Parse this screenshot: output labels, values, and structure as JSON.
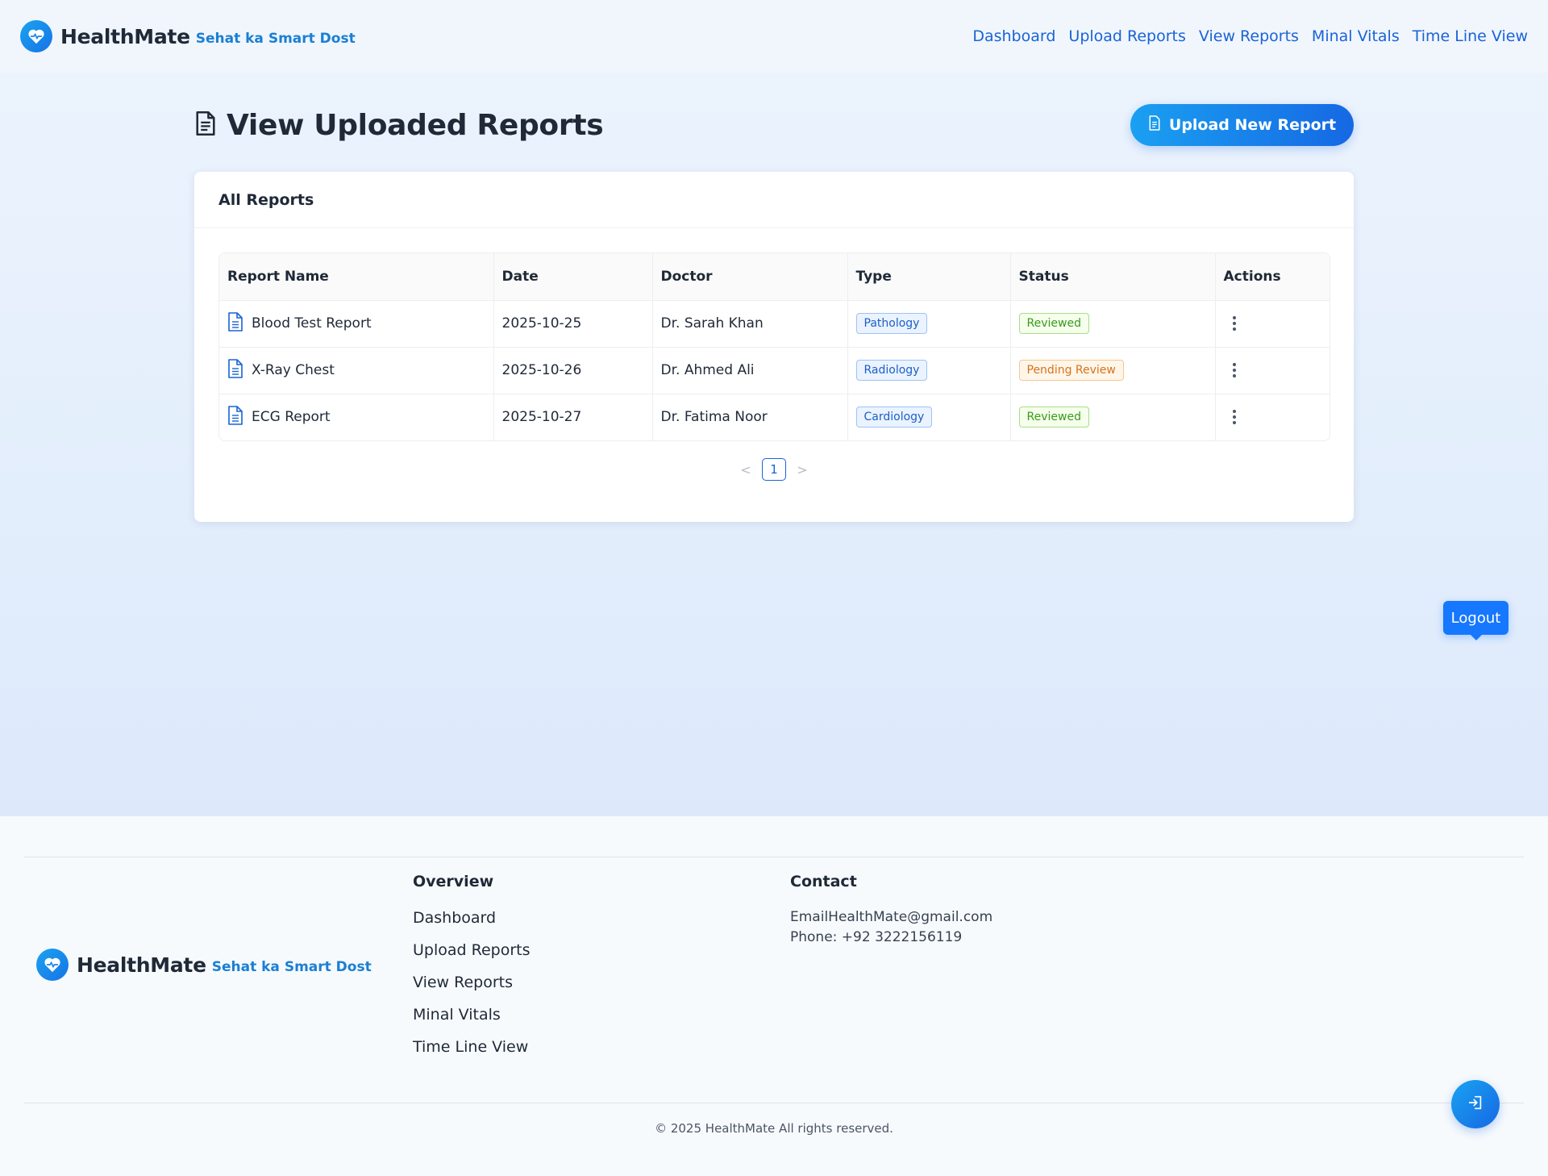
{
  "brand": {
    "name": "HealthMate",
    "tagline": "Sehat ka Smart Dost"
  },
  "nav": {
    "items": [
      {
        "label": "Dashboard"
      },
      {
        "label": "Upload Reports"
      },
      {
        "label": "View Reports"
      },
      {
        "label": "Minal Vitals"
      },
      {
        "label": "Time Line View"
      }
    ]
  },
  "page": {
    "title": "View Uploaded Reports",
    "upload_button_label": "Upload New Report"
  },
  "card": {
    "title": "All Reports",
    "columns": [
      "Report Name",
      "Date",
      "Doctor",
      "Type",
      "Status",
      "Actions"
    ],
    "rows": [
      {
        "name": "Blood Test Report",
        "date": "2025-10-25",
        "doctor": "Dr. Sarah Khan",
        "type": "Pathology",
        "status": "Reviewed",
        "status_color": "green"
      },
      {
        "name": "X-Ray Chest",
        "date": "2025-10-26",
        "doctor": "Dr. Ahmed Ali",
        "type": "Radiology",
        "status": "Pending Review",
        "status_color": "orange"
      },
      {
        "name": "ECG Report",
        "date": "2025-10-27",
        "doctor": "Dr. Fatima Noor",
        "type": "Cardiology",
        "status": "Reviewed",
        "status_color": "green"
      }
    ],
    "pagination": {
      "prev": "<",
      "current": "1",
      "next": ">"
    }
  },
  "logout_tooltip": "Logout",
  "footer": {
    "overview_title": "Overview",
    "overview_links": [
      "Dashboard",
      "Upload Reports",
      "View Reports",
      "Minal Vitals",
      "Time Line View"
    ],
    "contact_title": "Contact",
    "contact_email": "EmailHealthMate@gmail.com",
    "contact_phone": "Phone: +92 3222156119",
    "copyright": "© 2025 HealthMate All rights reserved."
  },
  "colors": {
    "accent": "#1a63d6",
    "brand_gradient_start": "#1aa3f0",
    "brand_gradient_end": "#1668e3"
  }
}
